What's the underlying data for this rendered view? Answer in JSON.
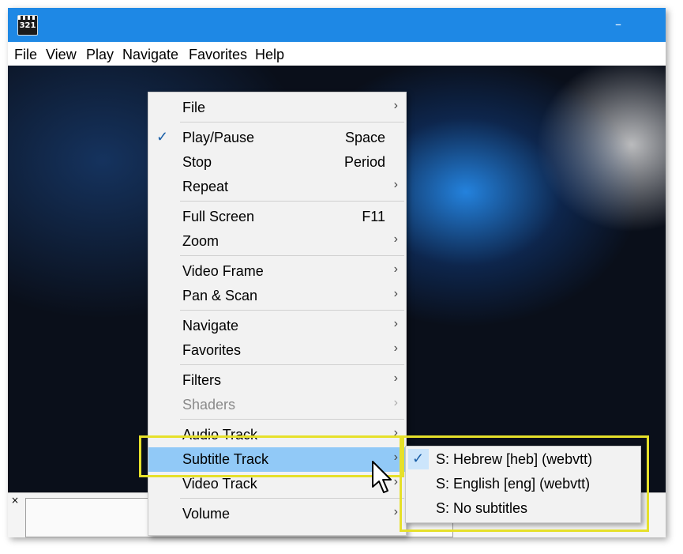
{
  "window": {
    "app_icon_text": "321",
    "minimize_glyph": "–"
  },
  "menubar": [
    "File",
    "View",
    "Play",
    "Navigate",
    "Favorites",
    "Help"
  ],
  "context_menu": [
    {
      "label": "File",
      "submenu": true
    },
    {
      "label": "Play/Pause",
      "shortcut": "Space",
      "checked": true
    },
    {
      "label": "Stop",
      "shortcut": "Period"
    },
    {
      "label": "Repeat",
      "submenu": true
    },
    {
      "label": "Full Screen",
      "shortcut": "F11"
    },
    {
      "label": "Zoom",
      "submenu": true
    },
    {
      "label": "Video Frame",
      "submenu": true
    },
    {
      "label": "Pan & Scan",
      "submenu": true
    },
    {
      "label": "Navigate",
      "submenu": true
    },
    {
      "label": "Favorites",
      "submenu": true
    },
    {
      "label": "Filters",
      "submenu": true
    },
    {
      "label": "Shaders",
      "submenu": true,
      "disabled": true
    },
    {
      "label": "Audio Track",
      "submenu": true
    },
    {
      "label": "Subtitle Track",
      "submenu": true,
      "highlighted": true
    },
    {
      "label": "Video Track",
      "submenu": true
    },
    {
      "label": "Volume",
      "submenu": true
    }
  ],
  "subtitle_submenu": [
    {
      "label": "S: Hebrew [heb] (webvtt)",
      "checked": true
    },
    {
      "label": "S: English [eng] (webvtt)"
    },
    {
      "label": "S: No subtitles"
    }
  ],
  "glyphs": {
    "check": "✓",
    "arrow": "›",
    "close": "×"
  },
  "colors": {
    "titlebar": "#1e88e5",
    "menu_bg": "#f2f2f2",
    "highlight": "#91c9f7",
    "annotation": "#e6e02a"
  }
}
